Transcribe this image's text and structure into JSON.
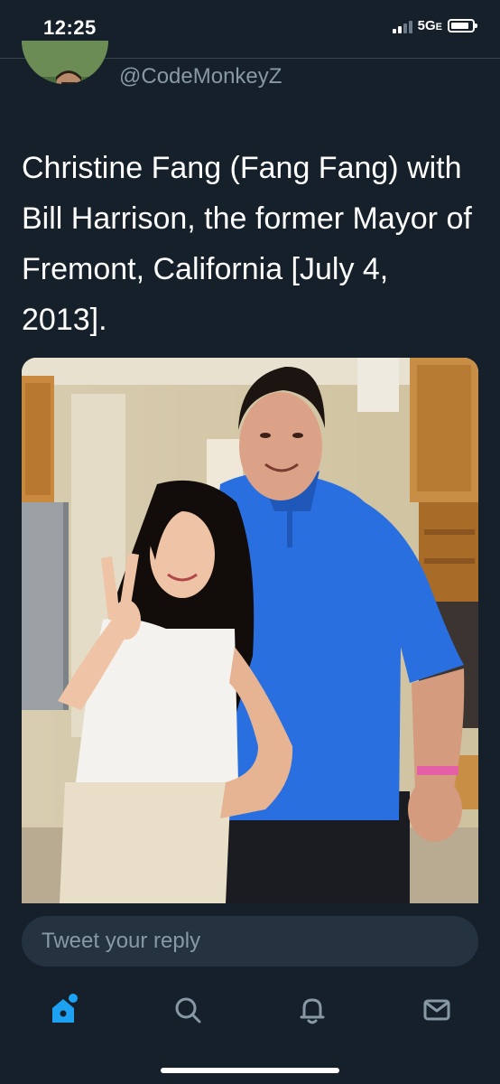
{
  "status_bar": {
    "time": "12:25",
    "network": "5G",
    "network_suffix": "E",
    "signal_bars_active": 2,
    "signal_bars_total": 4,
    "battery_level": 0.85
  },
  "tweet": {
    "handle": "@CodeMonkeyZ",
    "text": "Christine Fang (Fang Fang) with Bill Harrison, the former Mayor of Fremont, California [July 4, 2013].",
    "media_icon": "photo"
  },
  "reply": {
    "placeholder": "Tweet your reply"
  },
  "tab_bar": {
    "icons": [
      "home-icon",
      "search-icon",
      "notifications-icon",
      "messages-icon"
    ],
    "active": "home-icon",
    "notification_dot": true
  },
  "colors": {
    "background": "#15202b",
    "accent": "#1da1f2",
    "secondary_text": "#8899a6",
    "input_background": "#253341"
  }
}
